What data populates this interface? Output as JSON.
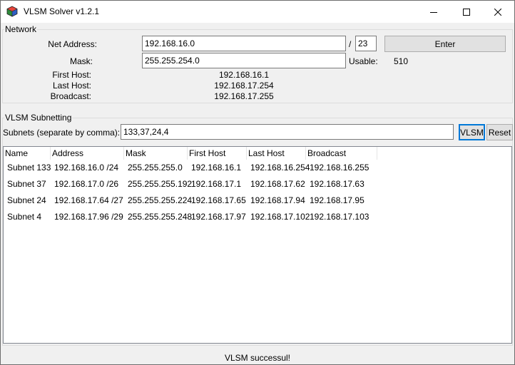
{
  "window": {
    "title": "VLSM Solver v1.2.1",
    "icon": "cube-app-icon"
  },
  "network": {
    "legend": "Network",
    "net_address_label": "Net Address:",
    "net_address_value": "192.168.16.0",
    "slash": "/",
    "prefix_value": "23",
    "enter_label": "Enter",
    "mask_label": "Mask:",
    "mask_value": "255.255.254.0",
    "usable_label": "Usable:",
    "usable_value": "510",
    "first_host_label": "First Host:",
    "first_host_value": "192.168.16.1",
    "last_host_label": "Last Host:",
    "last_host_value": "192.168.17.254",
    "broadcast_label": "Broadcast:",
    "broadcast_value": "192.168.17.255"
  },
  "vlsm": {
    "legend": "VLSM Subnetting",
    "subnets_label": "Subnets (separate by comma):",
    "subnets_value": "133,37,24,4",
    "vlsm_button": "VLSM",
    "reset_button": "Reset"
  },
  "table": {
    "columns": [
      "Name",
      "Address",
      "Mask",
      "First Host",
      "Last Host",
      "Broadcast"
    ],
    "rows": [
      [
        "Subnet 133",
        "192.168.16.0 /24",
        "255.255.255.0",
        "192.168.16.1",
        "192.168.16.254",
        "192.168.16.255"
      ],
      [
        "Subnet 37",
        "192.168.17.0 /26",
        "255.255.255.192",
        "192.168.17.1",
        "192.168.17.62",
        "192.168.17.63"
      ],
      [
        "Subnet 24",
        "192.168.17.64 /27",
        "255.255.255.224",
        "192.168.17.65",
        "192.168.17.94",
        "192.168.17.95"
      ],
      [
        "Subnet 4",
        "192.168.17.96 /29",
        "255.255.255.248",
        "192.168.17.97",
        "192.168.17.102",
        "192.168.17.103"
      ]
    ]
  },
  "status": {
    "text": "VLSM successul!"
  }
}
